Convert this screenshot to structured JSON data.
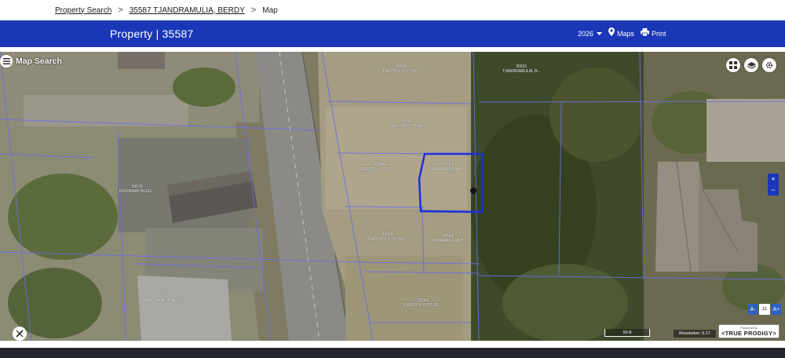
{
  "breadcrumb": {
    "items": [
      {
        "label": "Property Search",
        "link": true
      },
      {
        "label": "35587 TJANDRAMULIA, BERDY",
        "link": true
      },
      {
        "label": "Map",
        "link": false
      }
    ],
    "separator": ">"
  },
  "header": {
    "title": "Property | 35587",
    "year": "2026",
    "maps_label": "Maps",
    "print_label": "Print"
  },
  "map": {
    "title": "Map Search",
    "labels": [
      {
        "id": "35585",
        "owner": "DENTON, CITY OF..."
      },
      {
        "id": "35591",
        "owner": "TJANDRAMULIA, B..."
      },
      {
        "id": "35586",
        "owner": "DENTON, CITY OF..."
      },
      {
        "id": "35584",
        "owner": "DENTON, CITY OF..."
      },
      {
        "id": "35587",
        "owner": "TJANDRAMULIA, B..."
      },
      {
        "id": "35582",
        "owner": "DENTON, CITY OF..."
      },
      {
        "id": "35588",
        "owner": "TJANDRAMULIA, B..."
      },
      {
        "id": "35583",
        "owner": "DENTON, CITY OF..."
      },
      {
        "id": "35579",
        "owner": "RIVERWAY BLDG..."
      },
      {
        "id": "35577",
        "owner": "TEXAS HEALTH RE..."
      }
    ],
    "scale_label": "50 ft",
    "resolution_label": "Resolution: 0.17",
    "font_size_value": "11",
    "font_decrease": "A-",
    "font_increase": "A+",
    "zoom_in": "+",
    "zoom_out": "−",
    "powered_by": "Powered By",
    "brand": "<TRUE PRODIGY>"
  },
  "colors": {
    "header_bg": "#1a37b8",
    "parcel_line": "#6a6ee6",
    "selected_parcel": "#1a2fe0"
  }
}
